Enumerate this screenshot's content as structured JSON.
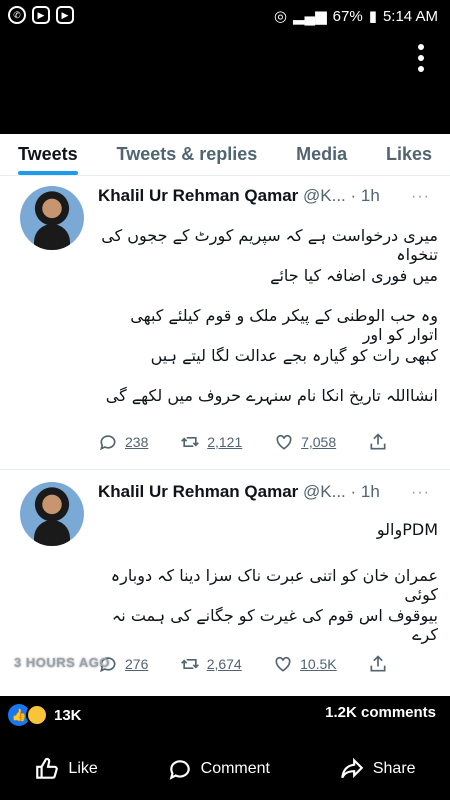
{
  "status": {
    "battery": "67%",
    "time": "5:14 AM"
  },
  "tabs": [
    "Tweets",
    "Tweets & replies",
    "Media",
    "Likes"
  ],
  "tweets": [
    {
      "name": "Khalil Ur Rehman Qamar",
      "handle": "@K...",
      "time": "· 1h",
      "lines": [
        "میری درخواست ہے کہ سپریم کورٹ کے ججوں کی تنخواہ",
        "میں فوری اضافہ کیا جائے",
        "وہ حب الوطنی کے پیکر ملک و قوم کیلئے کبھی اتوار کو اور",
        "کبھی رات کو گیارہ بجے عدالت لگا لیتے ہیں",
        "انشااللہ تاریخ انکا نام سنہرے حروف میں لکھے گی"
      ],
      "replies": "238",
      "retweets": "2,121",
      "likes": "7,058"
    },
    {
      "name": "Khalil Ur Rehman Qamar",
      "handle": "@K...",
      "time": "· 1h",
      "lines": [
        "PDMوالو",
        "عمران خان کو اتنی عبرت ناک سزا دینا کہ دوبارہ کوئی",
        "بیوقوف اس قوم کی غیرت کو جگانے کی ہمت نہ کرے"
      ],
      "replies": "276",
      "retweets": "2,674",
      "likes": "10.5K"
    }
  ],
  "overlay_time": "3 HOURS AGO",
  "facebook": {
    "reaction_count": "13K",
    "comments": "1.2K comments",
    "like": "Like",
    "comment": "Comment",
    "share": "Share"
  }
}
